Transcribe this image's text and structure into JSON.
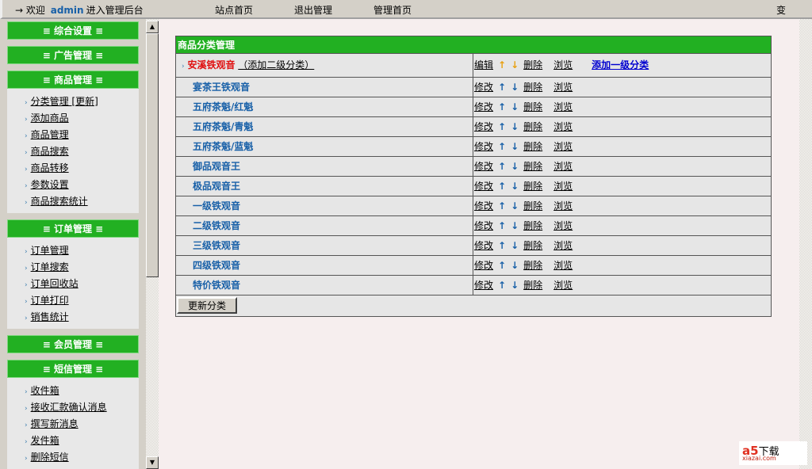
{
  "topbar": {
    "arrow": "→",
    "welcome": "欢迎",
    "user": "admin",
    "enter": "进入管理后台",
    "links": [
      "站点首页",
      "退出管理",
      "管理首页"
    ],
    "right": "变"
  },
  "sidebar": [
    {
      "title": "≡ 综合设置 ≡",
      "items": []
    },
    {
      "title": "≡ 广告管理 ≡",
      "items": []
    },
    {
      "title": "≡ 商品管理 ≡",
      "items": [
        "分类管理 [更新]",
        "添加商品",
        "商品管理",
        "商品搜索",
        "商品转移",
        "参数设置",
        "商品搜索统计"
      ]
    },
    {
      "title": "≡ 订单管理 ≡",
      "items": [
        "订单管理",
        "订单搜索",
        "订单回收站",
        "订单打印",
        "销售统计"
      ]
    },
    {
      "title": "≡ 会员管理 ≡",
      "items": []
    },
    {
      "title": "≡ 短信管理 ≡",
      "items": [
        "收件箱",
        "接收汇款确认消息",
        "撰写新消息",
        "发件箱",
        "删除短信"
      ]
    }
  ],
  "panel": {
    "title": "商品分类管理",
    "top": {
      "name": "安溪铁观音",
      "add_sub": "（添加二级分类）",
      "edit": "编辑",
      "up": "↑",
      "down": "↓",
      "delete": "删除",
      "browse": "浏览",
      "add_top": "添加一级分类"
    },
    "rows": [
      "宴茶王铁观音",
      "五府茶魁/红魁",
      "五府茶魁/青魁",
      "五府茶魁/蓝魁",
      "御品观音王",
      "极品观音王",
      "一级铁观音",
      "二级铁观音",
      "三级铁观音",
      "四级铁观音",
      "特价铁观音"
    ],
    "row_actions": {
      "edit": "修改",
      "up": "↑",
      "down": "↓",
      "delete": "删除",
      "browse": "浏览"
    },
    "update_button": "更新分类"
  },
  "watermark": {
    "brand": "a5",
    "text": "下载",
    "site": "xiazai.com"
  }
}
